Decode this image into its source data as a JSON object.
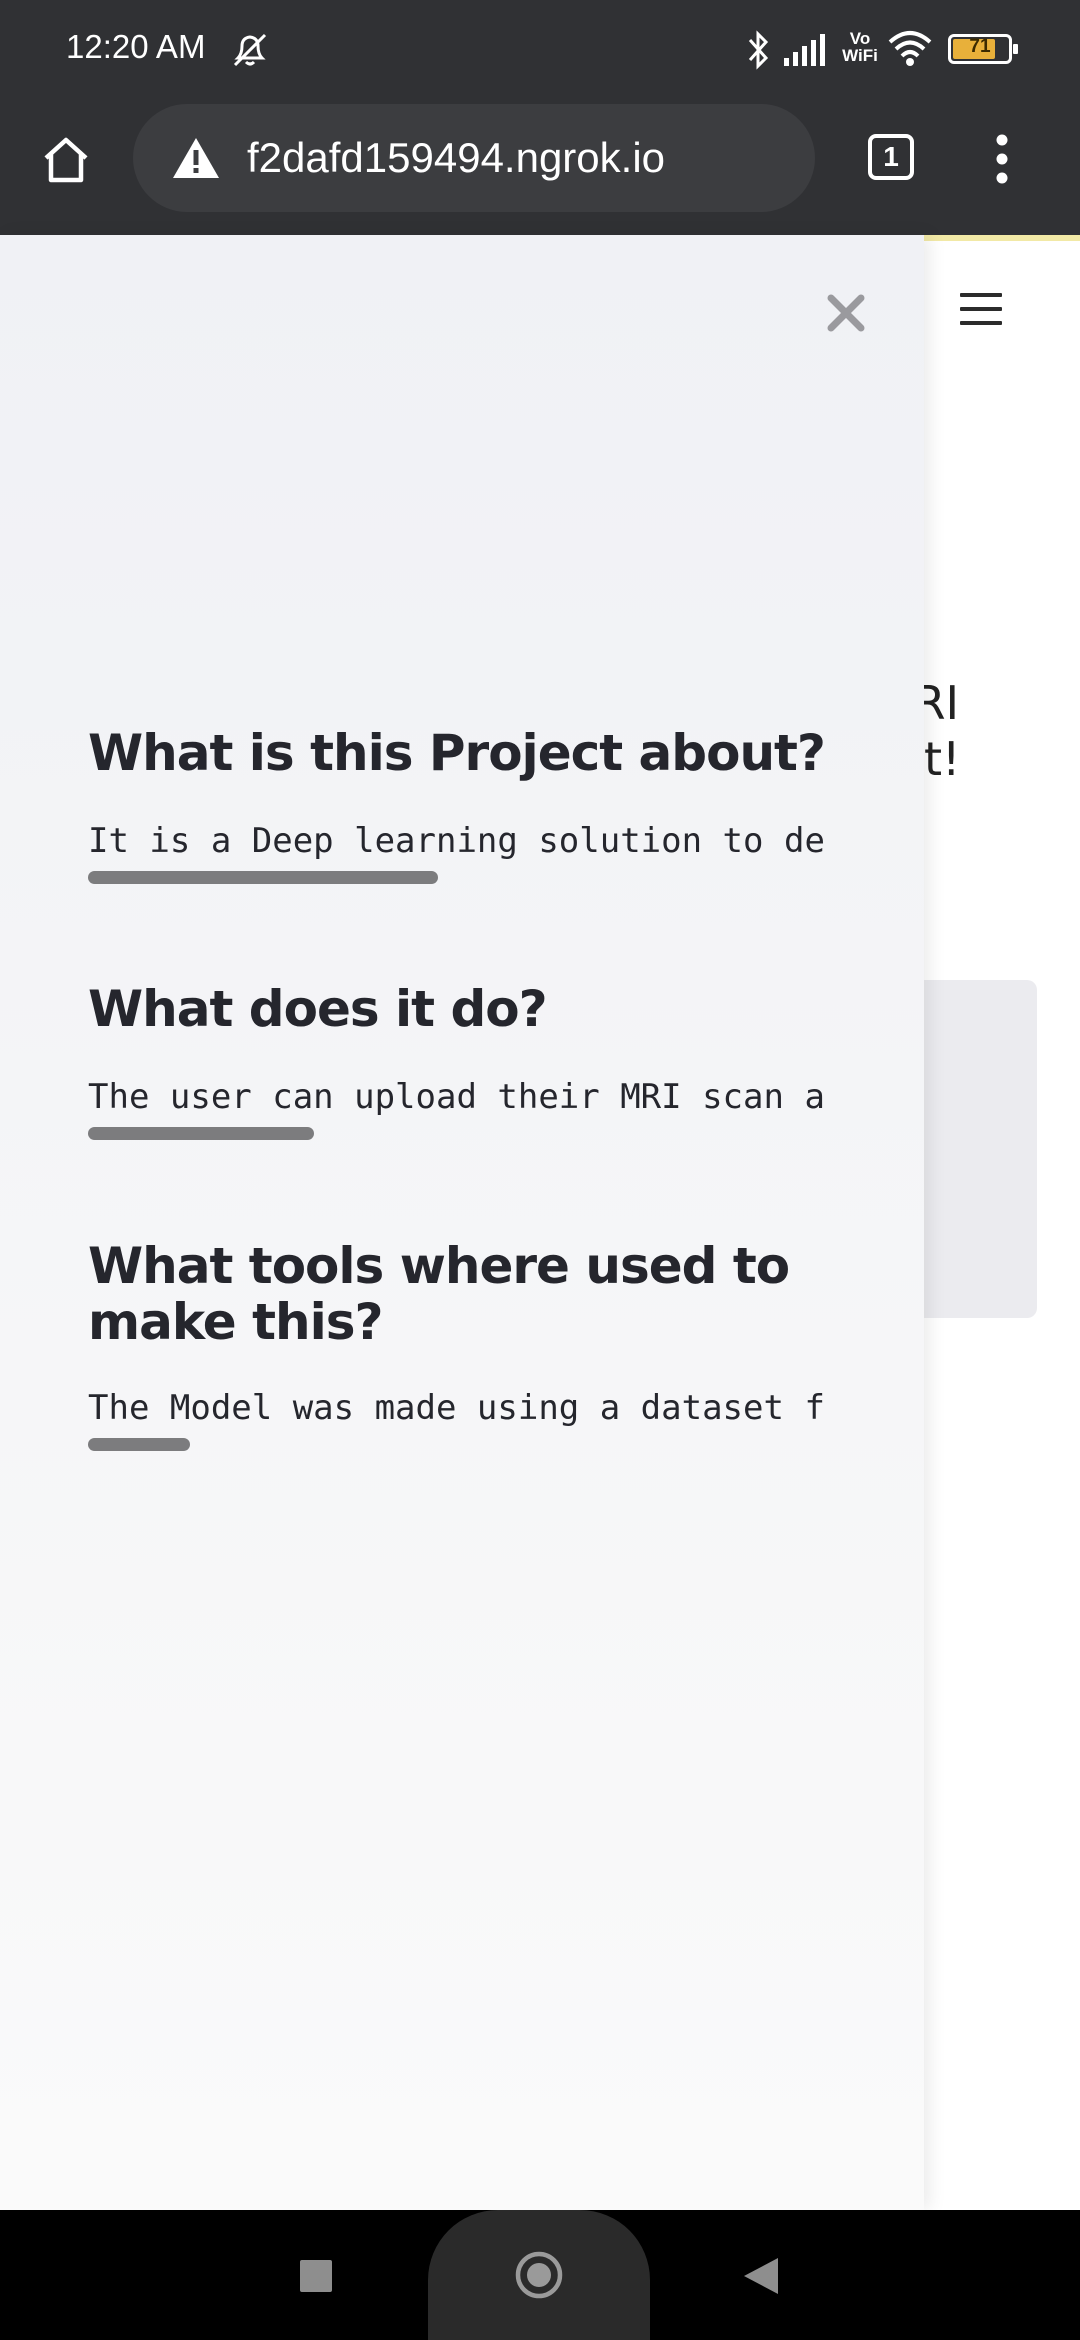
{
  "status_bar": {
    "time": "12:20 AM",
    "battery_level": "71",
    "icons": [
      "mute-alarm-icon",
      "bluetooth-icon",
      "signal-icon",
      "vowifi-icon",
      "wifi-icon",
      "battery-icon"
    ],
    "vowifi_top": "Vo",
    "vowifi_bottom": "WiFi"
  },
  "browser": {
    "url": "f2dafd159494.ngrok.io",
    "tab_count": "1",
    "icons": [
      "home-icon",
      "warning-icon",
      "tabs-icon",
      "menu-dots-icon"
    ]
  },
  "background_page": {
    "title_line1": "IRI",
    "title_line2": "st!"
  },
  "drawer": {
    "sections": [
      {
        "heading": "What is this Project about?",
        "text": "It is a Deep learning solution to de",
        "scroll_fraction": 0.31
      },
      {
        "heading": "What does it do?",
        "text": "The user can upload their MRI scan a",
        "scroll_fraction": 0.2
      },
      {
        "heading_line1": "What tools where used to",
        "heading_line2": "make this?",
        "text": "The Model was made using a dataset f",
        "scroll_fraction": 0.09
      }
    ]
  },
  "colors": {
    "status_bar_bg": "#303134",
    "drawer_bg": "#f0f1f5",
    "heading_text": "#25262d",
    "battery_fill": "#e8b03a"
  }
}
